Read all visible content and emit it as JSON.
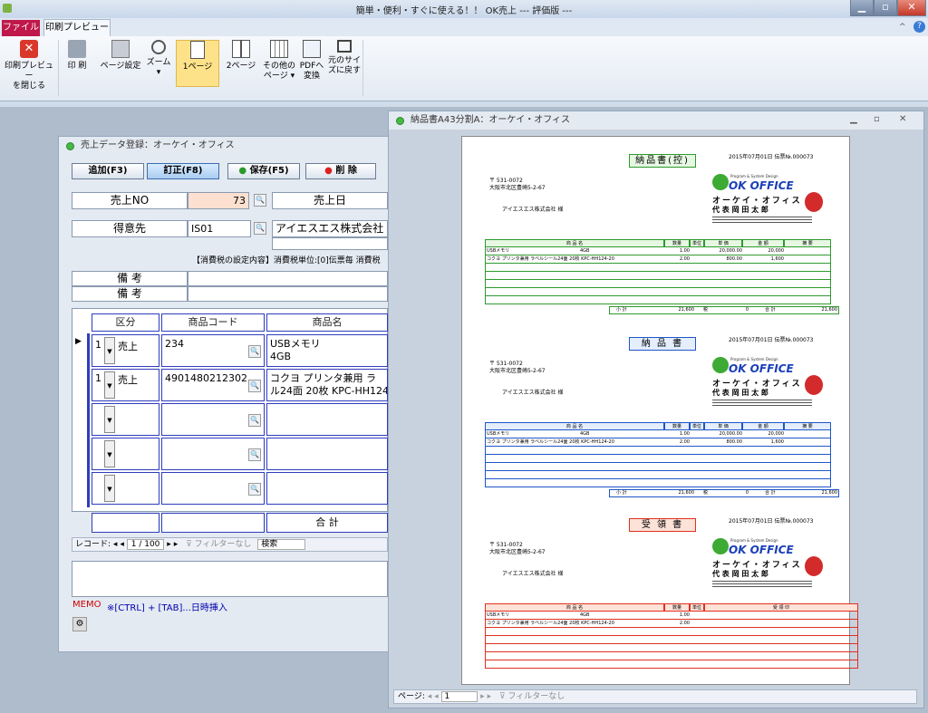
{
  "window": {
    "title": "簡単・便利・すぐに使える！！ OK売上 --- 評価版 ---"
  },
  "tabs": {
    "file": "ファイル",
    "preview": "印刷プレビュー"
  },
  "ribbon": {
    "buttons": [
      {
        "label1": "印刷プレビュー",
        "label2": "を閉じる"
      },
      {
        "label1": "印 刷",
        "label2": ""
      },
      {
        "label1": "ページ設定",
        "label2": ""
      },
      {
        "label1": "ズーム",
        "label2": "▾"
      },
      {
        "label1": "1ページ",
        "label2": ""
      },
      {
        "label1": "2ページ",
        "label2": ""
      },
      {
        "label1": "その他の",
        "label2": "ページ ▾"
      },
      {
        "label1": "PDFへ",
        "label2": "変換"
      },
      {
        "label1": "元のサイ",
        "label2": "ズに戻す"
      }
    ]
  },
  "form": {
    "title": "売上データ登録：オーケイ・オフィス",
    "toolbar": {
      "add": "追加(F3)",
      "edit": "訂正(F8)",
      "save": "保存(F5)",
      "delete": "削 除"
    },
    "sale_no_label": "売上NO",
    "sale_no": "73",
    "sale_date_label": "売上日",
    "customer_label": "得意先",
    "customer_code": "IS01",
    "customer_name": "アイエスエス株式会社",
    "tax_note": "【消費税の設定内容】消費税単位:[0]伝票毎 消費税",
    "remarks_label": "備 考",
    "grid": {
      "headers": [
        "区分",
        "商品コード",
        "商品名"
      ],
      "rows": [
        {
          "num": "1",
          "kbn": "売上",
          "code": "234",
          "name1": "USBメモリ",
          "name2": "4GB"
        },
        {
          "num": "1",
          "kbn": "売上",
          "code": "4901480212302",
          "name1": "コクヨ プリンタ兼用 ラ",
          "name2": "ル24面 20枚 KPC-HH124"
        }
      ],
      "total_label": "合 計"
    },
    "nav": {
      "record_label": "レコード:",
      "position": "1 / 100",
      "filter": "フィルターなし",
      "search": "検索"
    },
    "memo_label": "MEMO",
    "memo_hint": "※[CTRL] + [TAB]...日時挿入"
  },
  "preview": {
    "title": "納品書A43分割A：オーケイ・オフィス",
    "sections": [
      {
        "heading": "納品書(控)",
        "color": "#2e9a2e",
        "bg": "#e6f7e2"
      },
      {
        "heading": "納 品 書",
        "color": "#1f56c8",
        "bg": "#e4eefc"
      },
      {
        "heading": "受 領 書",
        "color": "#e03020",
        "bg": "#fde2d8"
      }
    ],
    "date_line": "2015年07月01日 伝票№.000073",
    "zip": "〒 531-0072",
    "address": "大阪市北区豊崎5-2-67",
    "recipient": "アイエスエス株式会社 様",
    "company_logo": "OK OFFICE",
    "company_tag": "Program & System Design",
    "company_name": "オーケイ・オフィス",
    "rep": "代 表 岡 田 太 郎",
    "table_headers": [
      "商 品 名",
      "数量",
      "単位",
      "単 価",
      "金 額",
      "摘 要"
    ],
    "receipt_headers": [
      "商 品 名",
      "数量",
      "単位",
      "受 領 印"
    ],
    "lines": [
      {
        "name": "USBメモリ",
        "spec": "4GB",
        "qty": "1.00",
        "price": "20,000.00",
        "amount": "20,000"
      },
      {
        "name": "コクヨ プリンタ兼用 ラベルシール24面 20枚 KPC-HH124-20",
        "spec": "",
        "qty": "2.00",
        "price": "800.00",
        "amount": "1,600"
      }
    ],
    "subtotal_label": "小 計",
    "subtotal": "21,600",
    "tax_label": "税",
    "tax": "0",
    "total_label": "合 計",
    "total": "21,600",
    "nav": {
      "page_label": "ページ:",
      "page": "1",
      "filter": "フィルターなし"
    }
  }
}
